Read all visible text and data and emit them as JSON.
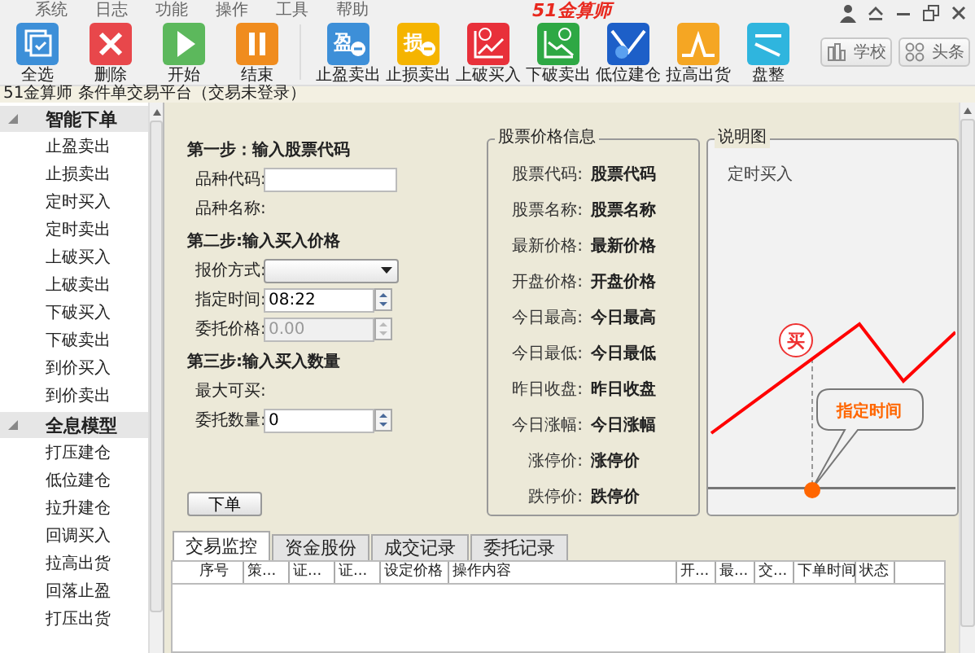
{
  "menu": [
    "系统",
    "日志",
    "功能",
    "操作",
    "工具",
    "帮助"
  ],
  "brand": "51金算师",
  "toolbar": [
    [
      {
        "label": "全选",
        "kind": "select",
        "color": "#3d8fd8"
      },
      {
        "label": "删除",
        "kind": "delete",
        "color": "#e8474b"
      },
      {
        "label": "开始",
        "kind": "play",
        "color": "#5cb85c"
      },
      {
        "label": "结束",
        "kind": "pause",
        "color": "#f08c1e"
      }
    ],
    [
      {
        "label": "止盈卖出",
        "kind": "badge",
        "glyph": "盈",
        "color": "#3d8fd8"
      },
      {
        "label": "止损卖出",
        "kind": "badge",
        "glyph": "损",
        "color": "#f5b400"
      },
      {
        "label": "上破买入",
        "kind": "rise",
        "color": "#e8303a"
      },
      {
        "label": "下破卖出",
        "kind": "fall",
        "color": "#2ea844"
      },
      {
        "label": "低位建仓",
        "kind": "dip",
        "color": "#1d5fc8"
      },
      {
        "label": "拉高出货",
        "kind": "peak",
        "color": "#f5a623"
      },
      {
        "label": "盘整",
        "kind": "flat",
        "color": "#2fb5de"
      }
    ]
  ],
  "side_buttons": [
    {
      "label": "学校",
      "kind": "school"
    },
    {
      "label": "头条",
      "kind": "news"
    }
  ],
  "title": "51金算师 条件单交易平台（交易未登录）",
  "sidebar": {
    "sections": [
      {
        "label": "智能下单",
        "expanded": true,
        "children": [
          {
            "label": "止盈卖出"
          },
          {
            "label": "止损卖出"
          },
          {
            "label": "定时买入"
          },
          {
            "label": "定时卖出"
          },
          {
            "label": "上破买入"
          },
          {
            "label": "上破卖出"
          },
          {
            "label": "下破买入"
          },
          {
            "label": "下破卖出"
          },
          {
            "label": "到价买入"
          },
          {
            "label": "到价卖出"
          }
        ]
      },
      {
        "label": "全息模型",
        "expanded": true,
        "children": [
          {
            "label": "打压建仓"
          },
          {
            "label": "低位建仓"
          },
          {
            "label": "拉升建仓"
          },
          {
            "label": "回调买入"
          },
          {
            "label": "拉高出货"
          },
          {
            "label": "回落止盈"
          },
          {
            "label": "打压出货"
          }
        ]
      }
    ]
  },
  "form": {
    "steps": [
      {
        "title": "第一步：输入股票代码",
        "fields": [
          {
            "label": "品种代码:",
            "kind": "text"
          },
          {
            "label": "品种名称:",
            "kind": "info"
          }
        ]
      },
      {
        "title": "第二步:输入买入价格",
        "fields": [
          {
            "label": "报价方式:",
            "kind": "select"
          },
          {
            "label": "指定时间:",
            "kind": "spin",
            "value": "08:22",
            "disabled": false
          },
          {
            "label": "委托价格:",
            "kind": "spin",
            "value": "0.00",
            "disabled": true
          }
        ]
      },
      {
        "title": "第三步:输入买入数量",
        "fields": [
          {
            "label": "最大可买:",
            "kind": "info"
          },
          {
            "label": "委托数量:",
            "kind": "spin",
            "value": "0",
            "disabled": false
          }
        ]
      }
    ],
    "submit": "下单"
  },
  "stock_info": {
    "title": "股票价格信息",
    "rows": [
      {
        "label": "股票代码:",
        "value": "股票代码"
      },
      {
        "label": "股票名称:",
        "value": "股票名称"
      },
      {
        "label": "最新价格:",
        "value": "最新价格"
      },
      {
        "label": "开盘价格:",
        "value": "开盘价格"
      },
      {
        "label": "今日最高:",
        "value": "今日最高"
      },
      {
        "label": "今日最低:",
        "value": "今日最低"
      },
      {
        "label": "昨日收盘:",
        "value": "昨日收盘"
      },
      {
        "label": "今日涨幅:",
        "value": "今日涨幅"
      },
      {
        "label": "涨停价:",
        "value": "涨停价"
      },
      {
        "label": "跌停价:",
        "value": "跌停价"
      }
    ]
  },
  "illustration": {
    "title": "说明图",
    "caption": "定时买入",
    "marker": "买",
    "callout": "指定时间"
  },
  "tabs": [
    {
      "label": "交易监控",
      "selected": true
    },
    {
      "label": "资金股份",
      "selected": false
    },
    {
      "label": "成交记录",
      "selected": false
    },
    {
      "label": "委托记录",
      "selected": false
    }
  ],
  "table": {
    "columns": [
      "序号",
      "策...",
      "证...",
      "证...",
      "设定价格",
      "操作内容",
      "开...",
      "最...",
      "交...",
      "下单时间",
      "状态"
    ]
  }
}
